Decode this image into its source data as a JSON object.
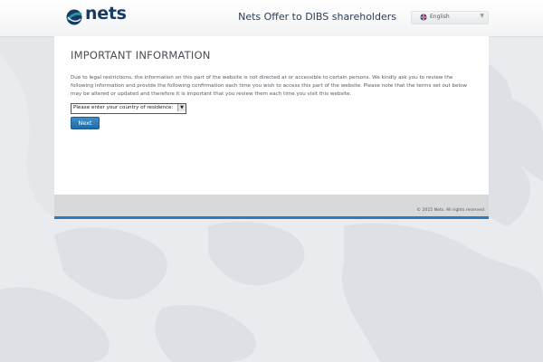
{
  "header": {
    "logo_text": "nets",
    "site_title": "Nets Offer to DIBS shareholders",
    "language": {
      "selected": "English"
    }
  },
  "main": {
    "heading": "IMPORTANT INFORMATION",
    "paragraph": "Due to legal restrictions, the information on this part of the website is not directed at or accessible to certain persons. We kindly ask you to review the following information and provide the following confirmation each time you wish to access this part of the website. Please note that the terms set out below may be altered or updated and therefore it is important that you review them each time you visit this website.",
    "country_select": {
      "selected": "Please enter your country of residence:"
    },
    "next_label": "Next"
  },
  "footer": {
    "copyright": "© 2015 Nets. All rights reserved"
  },
  "colors": {
    "accent": "#2a7cc0",
    "brand_navy": "#173b62",
    "brand_teal": "#2f8fa5"
  }
}
